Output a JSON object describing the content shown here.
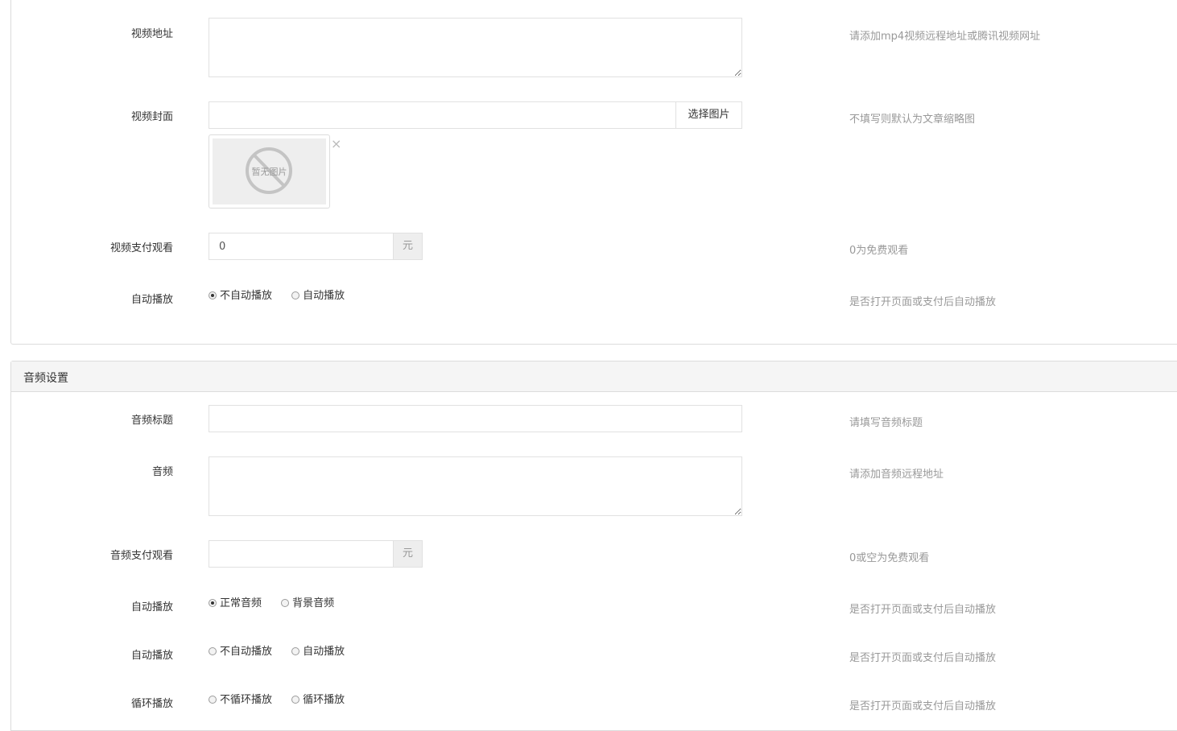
{
  "video": {
    "url": {
      "label": "视频地址",
      "value": "",
      "hint": "请添加mp4视频远程地址或腾讯视频网址"
    },
    "cover": {
      "label": "视频封面",
      "value": "",
      "button": "选择图片",
      "hint": "不填写则默认为文章缩略图",
      "placeholder_image_text": "暂无图片",
      "remove_symbol": "×"
    },
    "pay": {
      "label": "视频支付观看",
      "value": "0",
      "unit": "元",
      "hint": "0为免费观看"
    },
    "autoplay": {
      "label": "自动播放",
      "options": [
        {
          "text": "不自动播放",
          "checked": true
        },
        {
          "text": "自动播放",
          "checked": false
        }
      ],
      "hint": "是否打开页面或支付后自动播放"
    }
  },
  "audio": {
    "heading": "音频设置",
    "title": {
      "label": "音频标题",
      "value": "",
      "hint": "请填写音频标题"
    },
    "audio_url": {
      "label": "音频",
      "value": "",
      "hint": "请添加音频远程地址"
    },
    "pay": {
      "label": "音频支付观看",
      "value": "",
      "unit": "元",
      "hint": "0或空为免费观看"
    },
    "type": {
      "label": "自动播放",
      "options": [
        {
          "text": "正常音频",
          "checked": true
        },
        {
          "text": "背景音频",
          "checked": false
        }
      ],
      "hint": "是否打开页面或支付后自动播放"
    },
    "autoplay": {
      "label": "自动播放",
      "options": [
        {
          "text": "不自动播放",
          "checked": false
        },
        {
          "text": "自动播放",
          "checked": false
        }
      ],
      "hint": "是否打开页面或支付后自动播放"
    },
    "loop": {
      "label": "循环播放",
      "options": [
        {
          "text": "不循环播放",
          "checked": false
        },
        {
          "text": "循环播放",
          "checked": false
        }
      ],
      "hint": "是否打开页面或支付后自动播放"
    }
  }
}
